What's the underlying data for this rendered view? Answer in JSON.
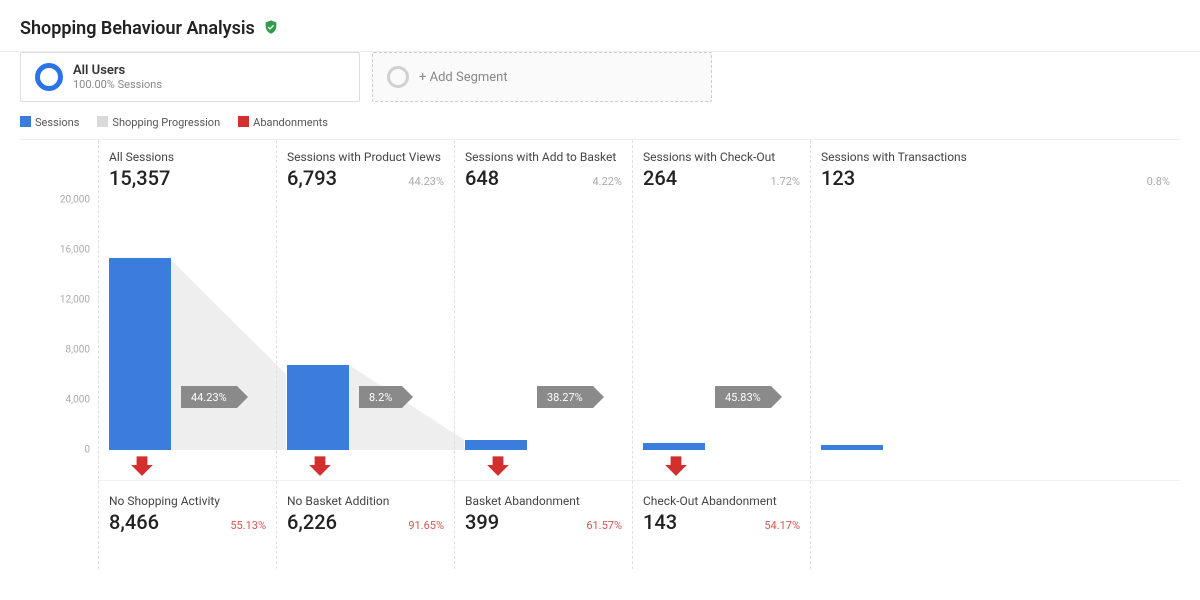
{
  "title": "Shopping Behaviour Analysis",
  "segment": {
    "name": "All Users",
    "sub": "100.00% Sessions"
  },
  "add_segment_label": "+ Add Segment",
  "legend": {
    "sessions": "Sessions",
    "progression": "Shopping Progression",
    "abandon": "Abandonments"
  },
  "y_ticks": [
    "20,000",
    "16,000",
    "12,000",
    "8,000",
    "4,000",
    "0"
  ],
  "chart_data": {
    "type": "bar",
    "title": "Shopping Behaviour Analysis funnel",
    "ylabel": "Sessions",
    "ylim": [
      0,
      20000
    ],
    "stages": [
      {
        "label": "All Sessions",
        "value": 15357,
        "value_fmt": "15,357",
        "pct": "",
        "progress_pct": "44.23%",
        "abandon_label": "No Shopping Activity",
        "abandon_value": 8466,
        "abandon_fmt": "8,466",
        "abandon_pct": "55.13%"
      },
      {
        "label": "Sessions with Product Views",
        "value": 6793,
        "value_fmt": "6,793",
        "pct": "44.23%",
        "progress_pct": "8.2%",
        "abandon_label": "No Basket Addition",
        "abandon_value": 6226,
        "abandon_fmt": "6,226",
        "abandon_pct": "91.65%"
      },
      {
        "label": "Sessions with Add to Basket",
        "value": 648,
        "value_fmt": "648",
        "pct": "4.22%",
        "progress_pct": "38.27%",
        "abandon_label": "Basket Abandonment",
        "abandon_value": 399,
        "abandon_fmt": "399",
        "abandon_pct": "61.57%"
      },
      {
        "label": "Sessions with Check-Out",
        "value": 264,
        "value_fmt": "264",
        "pct": "1.72%",
        "progress_pct": "45.83%",
        "abandon_label": "Check-Out Abandonment",
        "abandon_value": 143,
        "abandon_fmt": "143",
        "abandon_pct": "54.17%"
      },
      {
        "label": "Sessions with Transactions",
        "value": 123,
        "value_fmt": "123",
        "pct": "0.8%"
      }
    ]
  }
}
